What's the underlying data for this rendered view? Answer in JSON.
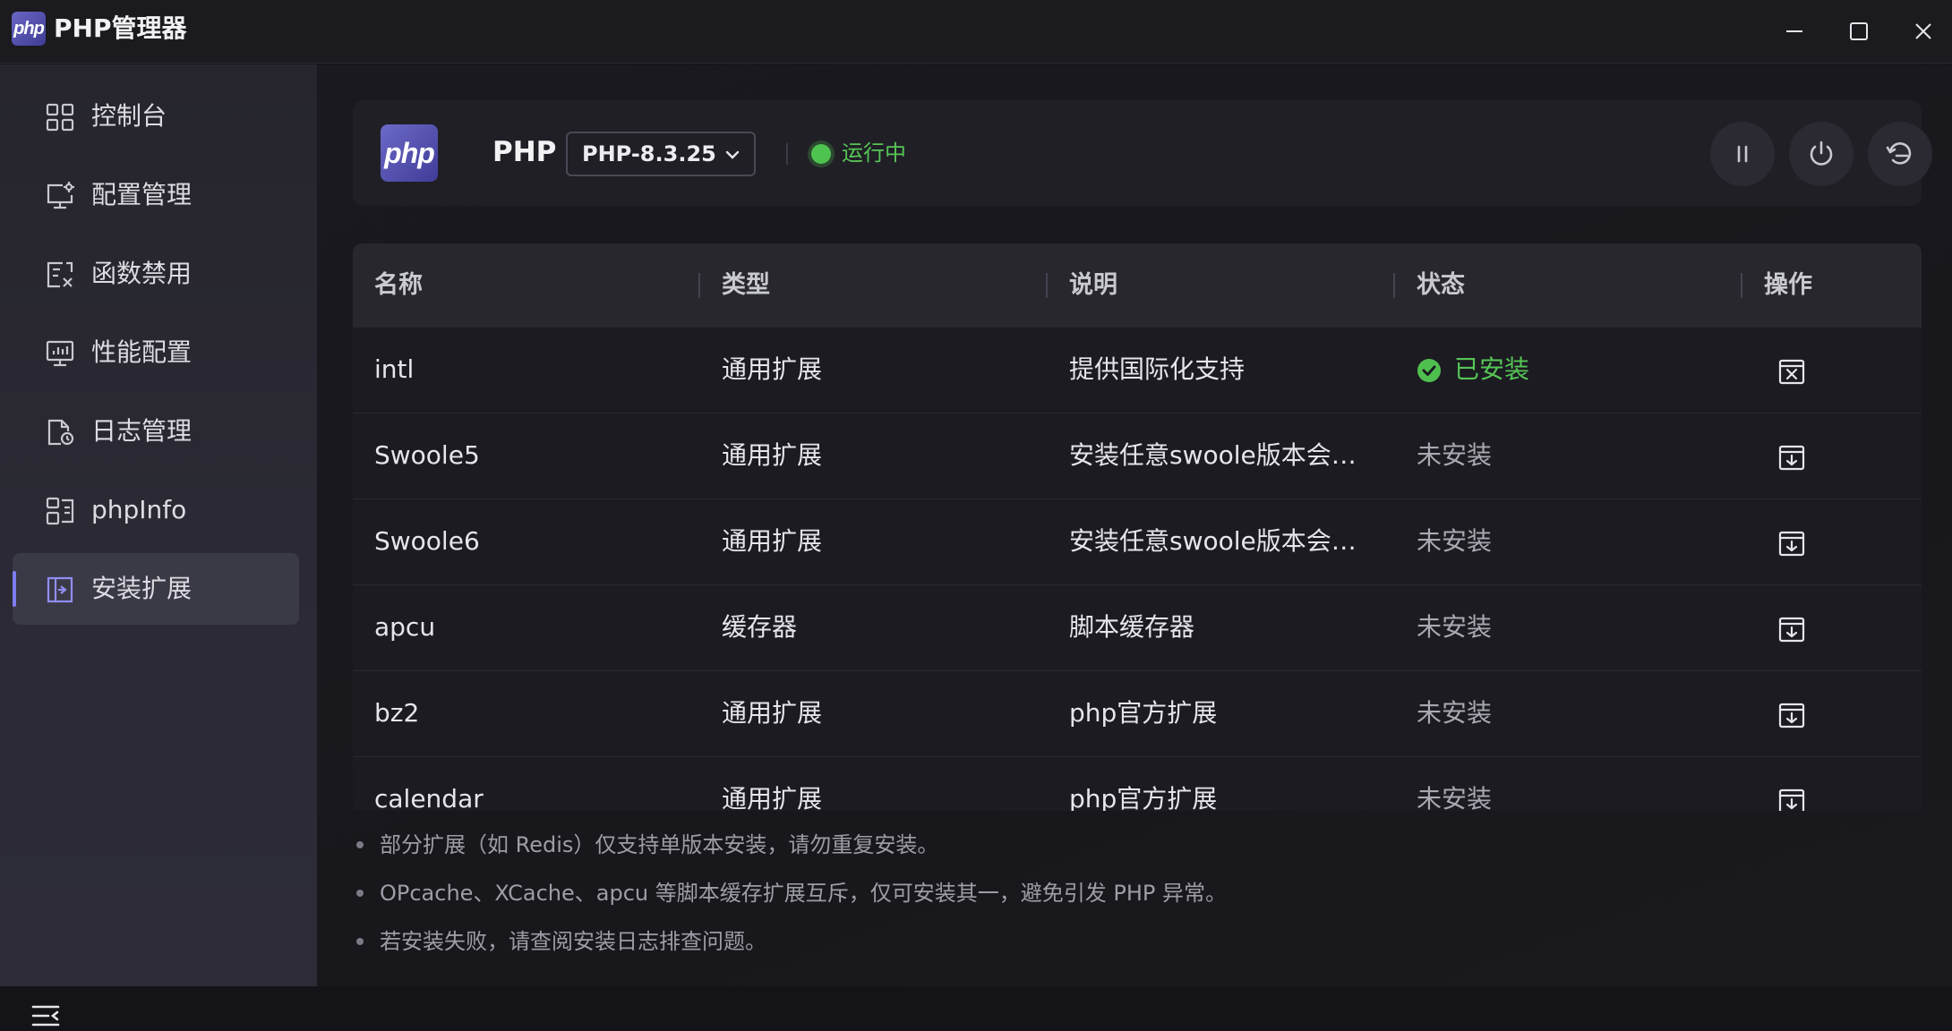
{
  "window": {
    "title": "PHP管理器",
    "logo_text": "php",
    "controls": [
      "minimize",
      "maximize",
      "close"
    ]
  },
  "sidebar": {
    "items": [
      {
        "label": "控制台",
        "icon": "dashboard-grid-icon",
        "active": false
      },
      {
        "label": "配置管理",
        "icon": "monitor-settings-icon",
        "active": false
      },
      {
        "label": "函数禁用",
        "icon": "function-disable-icon",
        "active": false
      },
      {
        "label": "性能配置",
        "icon": "performance-monitor-icon",
        "active": false
      },
      {
        "label": "日志管理",
        "icon": "log-file-icon",
        "active": false
      },
      {
        "label": "phpInfo",
        "icon": "php-info-icon",
        "active": false
      },
      {
        "label": "安装扩展",
        "icon": "install-extension-icon",
        "active": true
      }
    ],
    "toggle_icon": "collapse-menu-icon"
  },
  "header": {
    "logo_text": "php",
    "title": "PHP",
    "version": "PHP-8.3.25",
    "status": "运行中",
    "status_color": "#56c556",
    "actions": [
      "pause-icon",
      "power-icon",
      "restart-icon"
    ]
  },
  "table": {
    "columns": [
      "名称",
      "类型",
      "说明",
      "状态",
      "操作"
    ],
    "rows": [
      {
        "name": "intl",
        "type": "通用扩展",
        "desc": "提供国际化支持",
        "status": "已安装",
        "installed": true,
        "action_icon": "uninstall-icon"
      },
      {
        "name": "Swoole5",
        "type": "通用扩展",
        "desc": "安装任意swoole版本会显示的提示信息",
        "status": "未安装",
        "installed": false,
        "action_icon": "install-download-icon"
      },
      {
        "name": "Swoole6",
        "type": "通用扩展",
        "desc": "安装任意swoole版本会显示的提示信息",
        "status": "未安装",
        "installed": false,
        "action_icon": "install-download-icon"
      },
      {
        "name": "apcu",
        "type": "缓存器",
        "desc": "脚本缓存器",
        "status": "未安装",
        "installed": false,
        "action_icon": "install-download-icon"
      },
      {
        "name": "bz2",
        "type": "通用扩展",
        "desc": "php官方扩展",
        "status": "未安装",
        "installed": false,
        "action_icon": "install-download-icon"
      },
      {
        "name": "calendar",
        "type": "通用扩展",
        "desc": "php官方扩展",
        "status": "未安装",
        "installed": false,
        "action_icon": "install-download-icon"
      }
    ]
  },
  "notes": [
    "部分扩展（如 Redis）仅支持单版本安装，请勿重复安装。",
    "OPcache、XCache、apcu 等脚本缓存扩展互斥，仅可安装其一，避免引发 PHP 异常。",
    "若安装失败，请查阅安装日志排查问题。"
  ],
  "colors": {
    "accent": "#7d7cf0",
    "installed": "#56c556",
    "not_installed": "#a9a9b2"
  }
}
